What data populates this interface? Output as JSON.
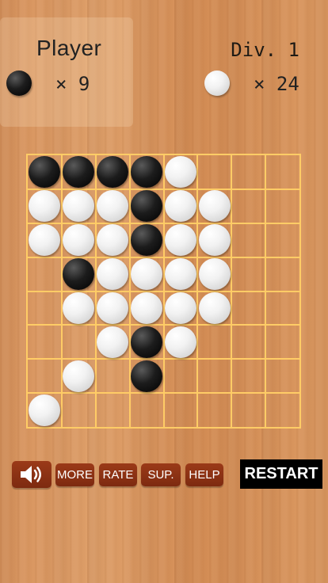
{
  "header": {
    "player_label": "Player",
    "division_label": "Div. 1",
    "black_count": "× 9",
    "white_count": "× 24"
  },
  "board": {
    "size": 8,
    "rows": [
      [
        "B",
        "B",
        "B",
        "B",
        "W",
        ".",
        ".",
        "."
      ],
      [
        "W",
        "W",
        "W",
        "B",
        "W",
        "W",
        ".",
        "."
      ],
      [
        "W",
        "W",
        "W",
        "B",
        "W",
        "W",
        ".",
        "."
      ],
      [
        ".",
        "B",
        "W",
        "W",
        "W",
        "W",
        ".",
        "."
      ],
      [
        ".",
        "W",
        "W",
        "W",
        "W",
        "W",
        ".",
        "."
      ],
      [
        ".",
        ".",
        "W",
        "B",
        "W",
        ".",
        ".",
        "."
      ],
      [
        ".",
        "W",
        ".",
        "B",
        ".",
        ".",
        ".",
        "."
      ],
      [
        "W",
        ".",
        ".",
        ".",
        ".",
        ".",
        ".",
        "."
      ]
    ]
  },
  "menu": {
    "sound_icon": "speaker-icon",
    "more_label": "MORE",
    "rate_label": "RATE",
    "sup_label": "SUP.",
    "help_label": "HELP",
    "restart_label": "RESTART"
  },
  "colors": {
    "board_lines": "#ffcc66",
    "menu_button": "#8b3214",
    "restart_button": "#000000"
  }
}
